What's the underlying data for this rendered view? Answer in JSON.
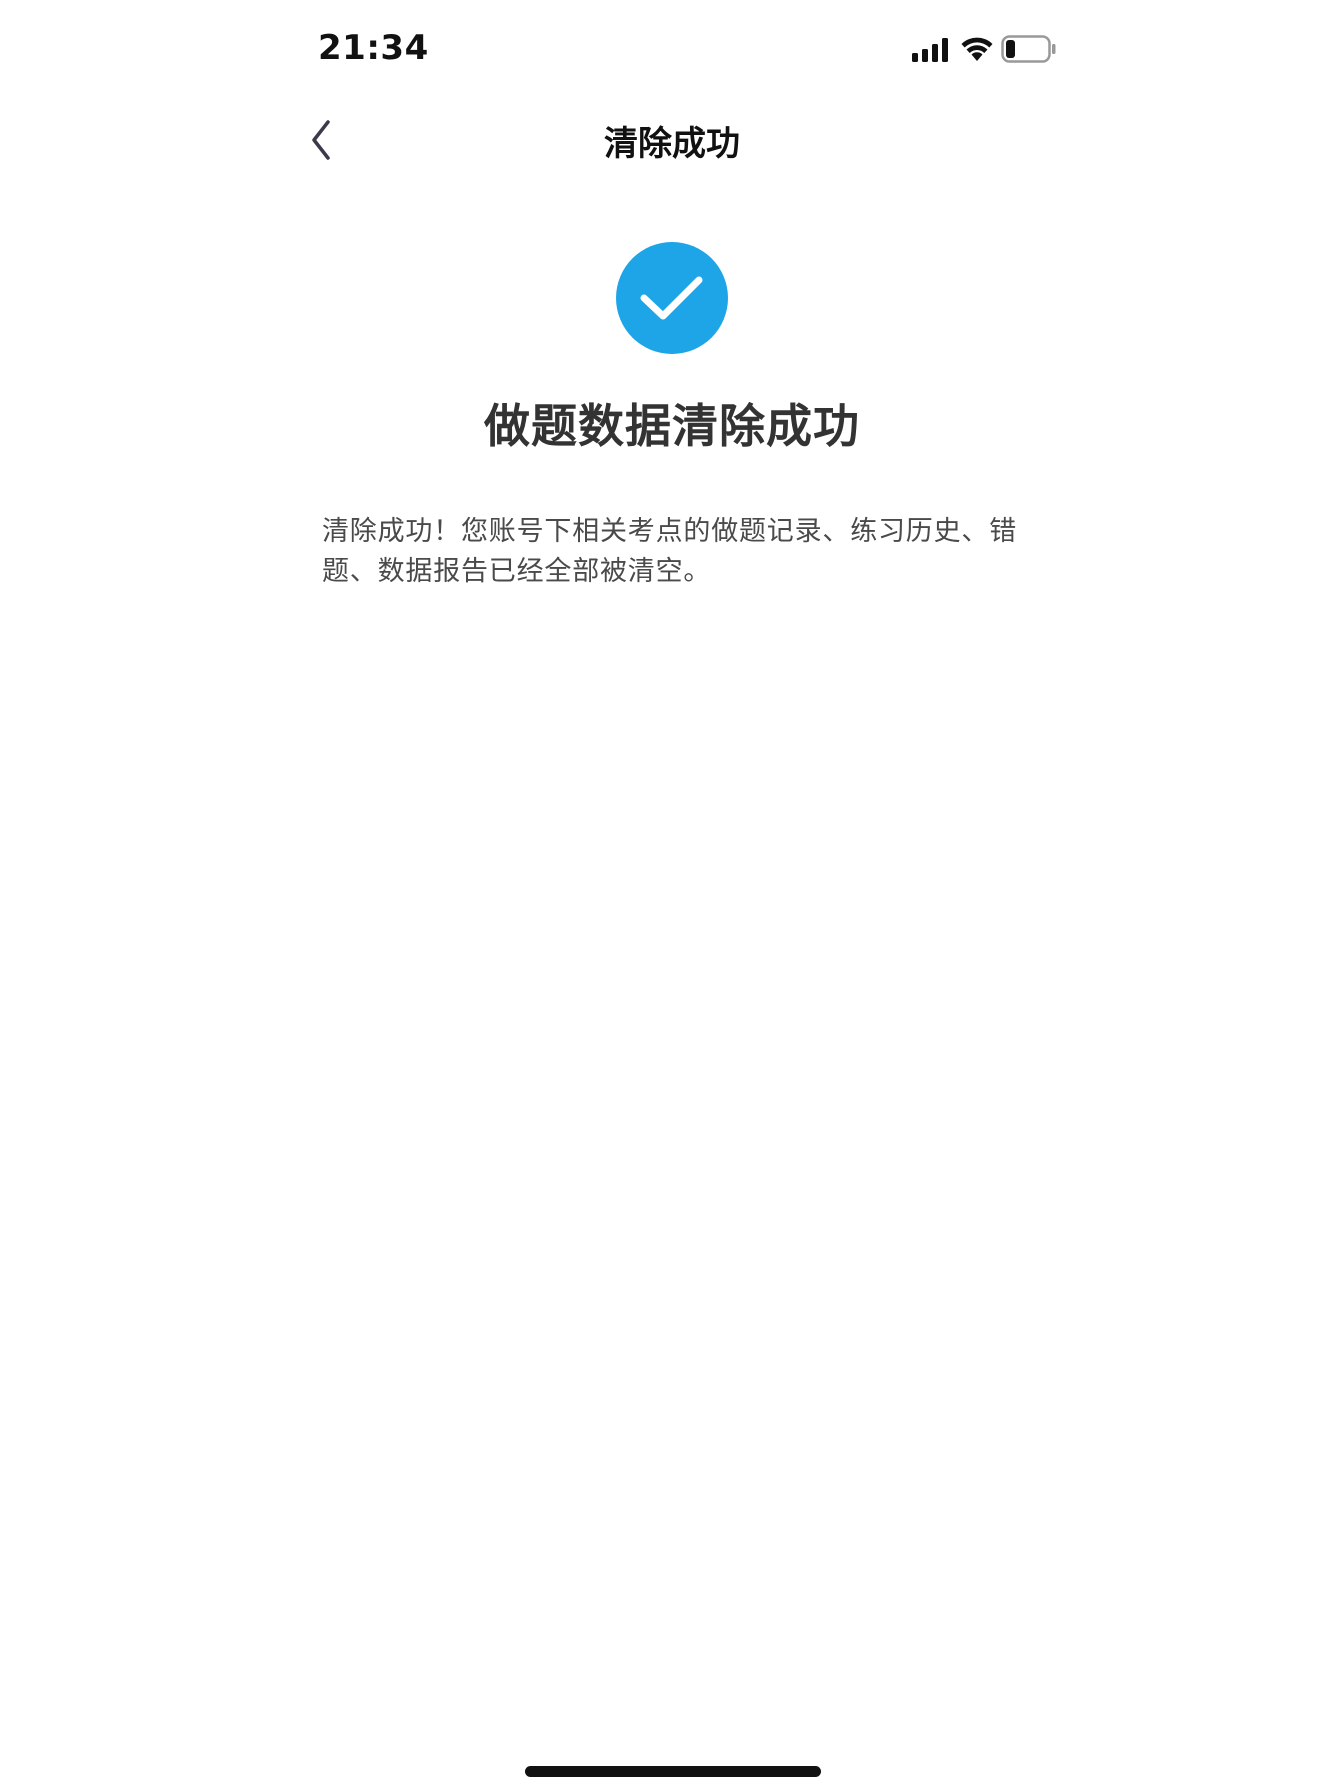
{
  "status_bar": {
    "time": "21:34",
    "icons": [
      "cellular-signal-icon",
      "wifi-icon",
      "battery-icon"
    ]
  },
  "nav": {
    "title": "清除成功",
    "back_icon": "chevron-left-icon"
  },
  "result": {
    "icon": "checkmark-circle-icon",
    "icon_color": "#1EA5E8",
    "title": "做题数据清除成功",
    "description": "清除成功！您账号下相关考点的做题记录、练习历史、错题、数据报告已经全部被清空。"
  }
}
